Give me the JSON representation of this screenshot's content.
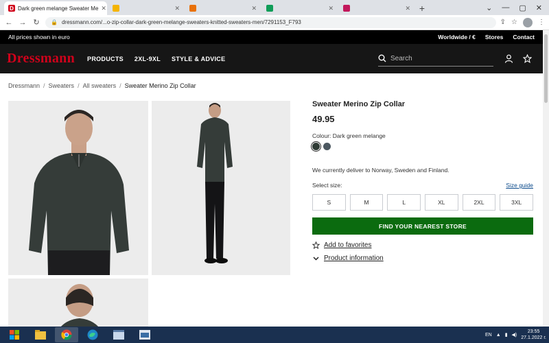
{
  "browser": {
    "tabs": [
      {
        "title": "Dark green melange Sweater Me",
        "active": true,
        "favicon": "D"
      },
      {
        "title": "",
        "active": false
      },
      {
        "title": "",
        "active": false
      },
      {
        "title": "",
        "active": false
      },
      {
        "title": "",
        "active": false
      }
    ],
    "url": "dressmann.com/...o-zip-collar-dark-green-melange-sweaters-knitted-sweaters-men/7291153_F793"
  },
  "topbar": {
    "left": "All prices shown in euro",
    "region": "Worldwide / €",
    "stores": "Stores",
    "contact": "Contact"
  },
  "nav": {
    "logo": "Dressmann",
    "links": [
      "PRODUCTS",
      "2XL-9XL",
      "STYLE & ADVICE"
    ],
    "search_placeholder": "Search"
  },
  "breadcrumb": [
    "Dressmann",
    "Sweaters",
    "All sweaters",
    "Sweater Merino Zip Collar"
  ],
  "product": {
    "title": "Sweater Merino Zip Collar",
    "price": "49.95",
    "colour_label": "Colour: Dark green melange",
    "swatch_colors": [
      "#2f3b35",
      "#4c5860"
    ],
    "delivery": "We currently deliver to Norway, Sweden and Finland.",
    "select_size": "Select size:",
    "size_guide": "Size guide",
    "sizes": [
      "S",
      "M",
      "L",
      "XL",
      "2XL",
      "3XL"
    ],
    "store_button": "FIND YOUR NEAREST STORE",
    "favorites": "Add to favorites",
    "product_info": "Product information"
  },
  "taskbar": {
    "lang": "EN",
    "time": "23:55",
    "date": "27.1.2022 г."
  },
  "colors": {
    "brand_red": "#d0021b",
    "store_green": "#0b6b0f",
    "sweater": "#353c39"
  }
}
